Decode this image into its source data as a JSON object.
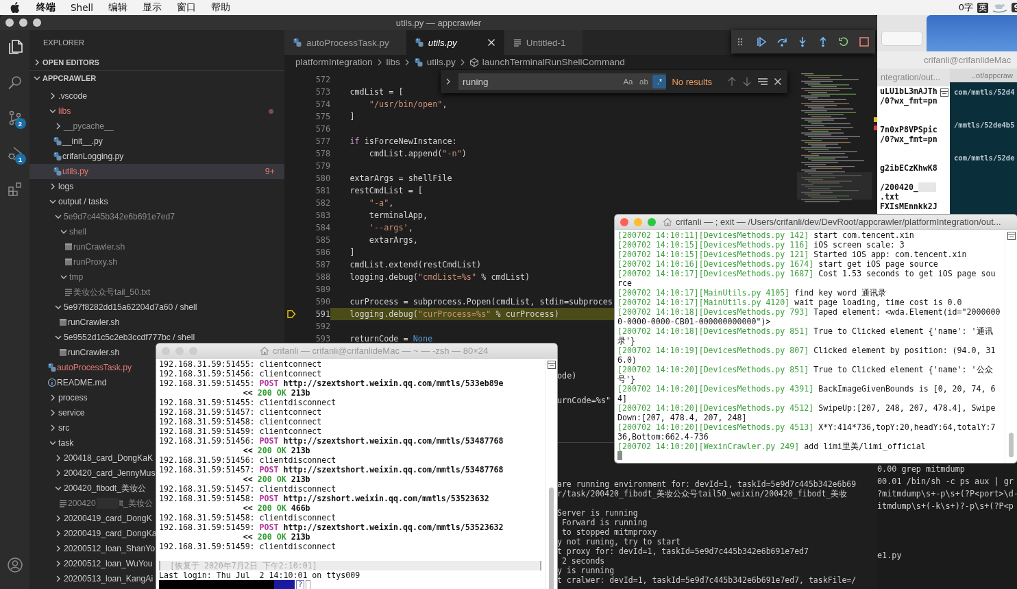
{
  "menubar": {
    "items": [
      "终端",
      "Shell",
      "编辑",
      "显示",
      "窗口",
      "帮助"
    ],
    "word_count": "0字",
    "input_method": "英"
  },
  "back_terminal": {
    "title": "crifanli@crifanlideMac",
    "tab": "..ot/appcraw",
    "upper_lines": [
      {
        "kind": "text",
        "text": "com/mmtls/52d4"
      },
      {
        "kind": "blank"
      },
      {
        "kind": "blank"
      },
      {
        "kind": "text",
        "text": "/mmtls/52de4b5"
      },
      {
        "kind": "blank"
      },
      {
        "kind": "blank"
      },
      {
        "kind": "text",
        "text": "com/mmtls/52de"
      }
    ],
    "lower_lines": [
      {
        "kind": "text",
        "text": "0.00 grep mitmdump"
      },
      {
        "kind": "text",
        "text": "00.01 /bin/sh -c ps aux | gr"
      },
      {
        "kind": "text",
        "text": "?mitmdump\\s+-p\\s+(?P<port>\\d-"
      },
      {
        "kind": "text",
        "text": "itmdump\\s+(-k\\s+)?-p\\s+(?P<p"
      },
      {
        "kind": "blank"
      },
      {
        "kind": "blank"
      },
      {
        "kind": "blank"
      },
      {
        "kind": "text",
        "text": "e1.py"
      }
    ]
  },
  "side_terminal": {
    "tab": "ntegration/out...",
    "lines": [
      {
        "kind": "text",
        "text": "uLU1bL3mAJTh"
      },
      {
        "kind": "text",
        "text": "/0?wx_fmt=pn"
      },
      {
        "kind": "blank"
      },
      {
        "kind": "blank"
      },
      {
        "kind": "text",
        "text": "7n0xP8VPSpic"
      },
      {
        "kind": "text",
        "text": "/0?wx_fmt=pn"
      },
      {
        "kind": "blank"
      },
      {
        "kind": "blank"
      },
      {
        "kind": "text",
        "text": "g2ibECzKhwK8"
      },
      {
        "kind": "blank"
      },
      {
        "kind": "redacted",
        "text": "/200420_"
      },
      {
        "kind": "text",
        "text": ".txt"
      },
      {
        "kind": "text",
        "text": "FXIsMEnnkk2J"
      }
    ]
  },
  "editor_window": {
    "title": "utils.py — appcrawler",
    "focused": false,
    "activity_bar": [
      {
        "kind": "files",
        "selected": true
      },
      {
        "kind": "search",
        "selected": false
      },
      {
        "kind": "source_control",
        "selected": false,
        "badge": "2"
      },
      {
        "kind": "debug",
        "selected": false,
        "badge": "1"
      },
      {
        "kind": "extensions",
        "selected": false
      }
    ],
    "sidebar": {
      "title": "EXPLORER",
      "sections": [
        {
          "label": "OPEN EDITORS",
          "expanded": false
        },
        {
          "label": "APPCRAWLER",
          "expanded": true
        }
      ],
      "tree": [
        {
          "name": ".vscode",
          "kind": "folder",
          "expanded": false,
          "selected": false,
          "modified": false,
          "ignored": false
        },
        {
          "name": "libs",
          "kind": "folder",
          "expanded": true,
          "selected": false,
          "modified": true,
          "ignored": false,
          "children": [
            {
              "name": "__pycache__",
              "kind": "folder",
              "expanded": false,
              "selected": false,
              "modified": false,
              "ignored": true
            },
            {
              "name": "__init__.py",
              "kind": "python",
              "selected": false,
              "modified": false,
              "ignored": false
            },
            {
              "name": "crifanLogging.py",
              "kind": "python",
              "selected": false,
              "modified": false,
              "ignored": false
            },
            {
              "name": "utils.py",
              "kind": "python",
              "selected": true,
              "modified": true,
              "ignored": false,
              "problems": "9+"
            }
          ]
        },
        {
          "name": "logs",
          "kind": "folder",
          "expanded": false,
          "selected": false,
          "modified": false,
          "ignored": false
        },
        {
          "name": "output / tasks",
          "kind": "folder",
          "expanded": true,
          "selected": false,
          "modified": false,
          "ignored": false,
          "children": [
            {
              "name": "5e9d7c445b342e6b691e7ed7",
              "kind": "folder",
              "expanded": true,
              "selected": false,
              "modified": false,
              "ignored": true,
              "children": [
                {
                  "name": "shell",
                  "kind": "folder",
                  "expanded": true,
                  "selected": false,
                  "modified": false,
                  "ignored": true,
                  "children": [
                    {
                      "name": "runCrawler.sh",
                      "kind": "shell",
                      "selected": false,
                      "modified": false,
                      "ignored": true
                    },
                    {
                      "name": "runProxy.sh",
                      "kind": "shell",
                      "selected": false,
                      "modified": false,
                      "ignored": true
                    }
                  ]
                },
                {
                  "name": "tmp",
                  "kind": "folder",
                  "expanded": true,
                  "selected": false,
                  "modified": false,
                  "ignored": true,
                  "children": [
                    {
                      "name": "美妆公众号tail_50.txt",
                      "kind": "text",
                      "selected": false,
                      "modified": false,
                      "ignored": true
                    }
                  ]
                }
              ]
            },
            {
              "name": "5e97f8282dd15a62204d7a60 / shell",
              "kind": "folder",
              "expanded": true,
              "selected": false,
              "modified": false,
              "ignored": false,
              "children": [
                {
                  "name": "runCrawler.sh",
                  "kind": "shell",
                  "selected": false,
                  "modified": false,
                  "ignored": false
                }
              ]
            },
            {
              "name": "5e9552d1c5c2eb3ccdf777bc / shell",
              "kind": "folder",
              "expanded": true,
              "selected": false,
              "modified": false,
              "ignored": false,
              "children": [
                {
                  "name": "runCrawler.sh",
                  "kind": "shell",
                  "selected": false,
                  "modified": false,
                  "ignored": false
                }
              ]
            }
          ]
        },
        {
          "name": "autoProcessTask.py",
          "kind": "python",
          "selected": false,
          "modified": true,
          "ignored": false
        },
        {
          "name": "README.md",
          "kind": "info",
          "selected": false,
          "modified": false,
          "ignored": false
        },
        {
          "name": "process",
          "kind": "folder",
          "expanded": false,
          "selected": false,
          "modified": false,
          "ignored": false
        },
        {
          "name": "service",
          "kind": "folder",
          "expanded": false,
          "selected": false,
          "modified": false,
          "ignored": false
        },
        {
          "name": "src",
          "kind": "folder",
          "expanded": false,
          "selected": false,
          "modified": false,
          "ignored": false
        },
        {
          "name": "task",
          "kind": "folder",
          "expanded": true,
          "selected": false,
          "modified": false,
          "ignored": false,
          "children": [
            {
              "name": "200418_card_DongKaK",
              "kind": "folder",
              "expanded": false,
              "selected": false,
              "modified": false,
              "ignored": false
            },
            {
              "name": "200420_card_JennyMus",
              "kind": "folder",
              "expanded": false,
              "selected": false,
              "modified": false,
              "ignored": false
            },
            {
              "name": "200420_fibodt_美妆公",
              "kind": "folder",
              "expanded": true,
              "selected": false,
              "modified": false,
              "ignored": false,
              "children": [
                {
                  "name": "200420",
                  "name_after_redaction": "lt_美妆公",
                  "kind": "text",
                  "selected": false,
                  "modified": false,
                  "ignored": true
                }
              ]
            },
            {
              "name": "20200419_card_DongK",
              "kind": "folder",
              "expanded": false,
              "selected": false,
              "modified": false,
              "ignored": false
            },
            {
              "name": "20200419_card_DongKa",
              "kind": "folder",
              "expanded": false,
              "selected": false,
              "modified": false,
              "ignored": false
            },
            {
              "name": "20200512_loan_ShanYo",
              "kind": "folder",
              "expanded": false,
              "selected": false,
              "modified": false,
              "ignored": false
            },
            {
              "name": "20200512_loan_WuYou",
              "kind": "folder",
              "expanded": false,
              "selected": false,
              "modified": false,
              "ignored": false
            },
            {
              "name": "20200513_loan_KangAi",
              "kind": "folder",
              "expanded": false,
              "selected": false,
              "modified": false,
              "ignored": false
            }
          ]
        }
      ]
    },
    "tabs": [
      {
        "label": "autoProcessTask.py",
        "kind": "python",
        "selected": false
      },
      {
        "label": "utils.py",
        "kind": "python",
        "selected": true
      },
      {
        "label": "Untitled-1",
        "kind": "text",
        "selected": false
      }
    ],
    "breadcrumbs": [
      {
        "label": "platformIntegration",
        "kind": "folder"
      },
      {
        "label": "libs",
        "kind": "folder"
      },
      {
        "label": "utils.py",
        "kind": "python"
      },
      {
        "label": "launchTerminalRunShellCommand",
        "kind": "symbol"
      }
    ],
    "find_widget": {
      "value": "runing",
      "options": [
        {
          "label": "Aa",
          "on": false
        },
        {
          "label": "ab",
          "on": false
        },
        {
          "label": ".*",
          "on": true
        }
      ],
      "result": "No results"
    },
    "debug_toolbar": [
      {
        "kind": "grip"
      },
      {
        "kind": "continue"
      },
      {
        "kind": "step_over"
      },
      {
        "kind": "step_into"
      },
      {
        "kind": "step_out"
      },
      {
        "kind": "restart"
      },
      {
        "kind": "stop"
      }
    ],
    "code_lines": [
      {
        "kind": "line",
        "number": "572",
        "current": false
      },
      {
        "kind": "line",
        "number": "573",
        "text": "    cmdList = [",
        "current": false
      },
      {
        "kind": "line",
        "number": "574",
        "text": "        \"/usr/bin/open\",",
        "current": false
      },
      {
        "kind": "line",
        "number": "575",
        "text": "    ]",
        "current": false
      },
      {
        "kind": "line",
        "number": "576",
        "current": false
      },
      {
        "kind": "line",
        "number": "577",
        "text": "    if isForceNewInstance:",
        "current": false
      },
      {
        "kind": "line",
        "number": "578",
        "text": "        cmdList.append(\"-n\")",
        "current": false
      },
      {
        "kind": "line",
        "number": "579",
        "current": false
      },
      {
        "kind": "line",
        "number": "580",
        "text": "    extarArgs = shellFile",
        "current": false
      },
      {
        "kind": "line",
        "number": "581",
        "text": "    restCmdList = [",
        "current": false
      },
      {
        "kind": "line",
        "number": "582",
        "text": "        \"-a\",",
        "current": false
      },
      {
        "kind": "line",
        "number": "583",
        "text": "        terminalApp,",
        "current": false
      },
      {
        "kind": "line",
        "number": "584",
        "text": "        '--args',",
        "current": false
      },
      {
        "kind": "line",
        "number": "585",
        "text": "        extarArgs,",
        "current": false
      },
      {
        "kind": "line",
        "number": "586",
        "text": "    ]",
        "current": false
      },
      {
        "kind": "line",
        "number": "587",
        "text": "    cmdList.extend(restCmdList)",
        "current": false
      },
      {
        "kind": "line",
        "number": "588",
        "text": "    logging.debug(\"cmdList=%s\" % cmdList)",
        "current": false
      },
      {
        "kind": "line",
        "number": "589",
        "current": false
      },
      {
        "kind": "line",
        "number": "590",
        "text": "    curProcess = subprocess.Popen(cmdList, stdin=subproces",
        "current": false
      },
      {
        "kind": "line",
        "number": "591",
        "text": "    logging.debug(\"curProcess=%s\" % curProcess)",
        "current": true
      },
      {
        "kind": "line",
        "number": "592",
        "current": false
      },
      {
        "kind": "line",
        "number": "593",
        "text": "    returnCode = None",
        "current": false
      },
      {
        "kind": "covered"
      },
      {
        "kind": "covered"
      },
      {
        "kind": "fragment",
        "text": "ode)"
      },
      {
        "kind": "covered"
      },
      {
        "kind": "fragment",
        "text": "urnCode=%s\""
      }
    ],
    "panel_lines": [
      {
        "kind": "text",
        "text": "are running environment for: devId=1, taskId=5e9d7c445b342e6b69"
      },
      {
        "kind": "text",
        "text": "r/task/200420_fibodt_美妆公众号tail50_weixin/200420_fibodt_美妆"
      },
      {
        "kind": "blank"
      },
      {
        "kind": "text",
        "text": "Server is running"
      },
      {
        "kind": "text",
        "text": " Forward is running"
      },
      {
        "kind": "text",
        "text": " to stopped mitmproxy"
      },
      {
        "kind": "text",
        "text": "y not runing, try to start"
      },
      {
        "kind": "text",
        "text": "t proxy for: devId=1, taskId=5e9d7c445b342e6b691e7ed7"
      },
      {
        "kind": "text",
        "text": " 2 seconds"
      },
      {
        "kind": "text",
        "text": "y is running"
      },
      {
        "kind": "text",
        "text": "t cralwer: devId=1, taskId=5e9d7c445b342e6b691e7ed7, taskFile=/"
      }
    ]
  },
  "right_terminal": {
    "title": "crifanli — ; exit — /Users/crifanli/dev/DevRoot/appcrawler/platformIntegration/out...",
    "focused": true,
    "lines": [
      {
        "prefix": "[200702 14:10:11][DevicesMethods.py 142]",
        "message": "start com.tencent.xin"
      },
      {
        "prefix": "[200702 14:10:15][DevicesMethods.py 116]",
        "message": "iOS screen scale: 3"
      },
      {
        "prefix": "[200702 14:10:15][DevicesMethods.py 121]",
        "message": "Started iOS app: com.tencent.xin"
      },
      {
        "prefix": "[200702 14:10:16][DevicesMethods.py 1674]",
        "message": "start get iOS page source"
      },
      {
        "prefix": "[200702 14:10:17][DevicesMethods.py 1687]",
        "message": "Cost 1.53 seconds to get iOS page source"
      },
      {
        "prefix": "[200702 14:10:17][MainUtils.py 4105]",
        "message": "find key word 通讯录"
      },
      {
        "prefix": "[200702 14:10:17][MainUtils.py 4120]",
        "message": "wait page loading, time cost is 0.0"
      },
      {
        "prefix": "[200702 14:10:18][DevicesMethods.py 793]",
        "message": "Taped element: <wda.Element(id=\"20000000-0000-0000-CB01-000000000000\")>"
      },
      {
        "prefix": "[200702 14:10:18][DevicesMethods.py 851]",
        "message": "True to Clicked element {'name': '通讯录'}"
      },
      {
        "prefix": "[200702 14:10:19][DevicesMethods.py 807]",
        "message": "Clicked element by position: (94.0, 316.0)"
      },
      {
        "prefix": "[200702 14:10:20][DevicesMethods.py 851]",
        "message": "True to Clicked element {'name': '公众号'}"
      },
      {
        "prefix": "[200702 14:10:20][DevicesMethods.py 4391]",
        "message": "BackImageGivenBounds is [0, 20, 74, 64]"
      },
      {
        "prefix": "[200702 14:10:20][DevicesMethods.py 4512]",
        "message": "SwipeUp:[207, 248, 207, 478.4], SwipeDown:[207, 478.4, 207, 248]"
      },
      {
        "prefix": "[200702 14:10:20][DevicesMethods.py 4513]",
        "message": "X*Y:414*736,topY:20,headY:64,totalY:736,Bottom:662.4-736"
      },
      {
        "prefix": "[200702 14:10:20][WexinCrawler.py 249]",
        "message": "add limi里美/limi_official"
      }
    ]
  },
  "left_terminal": {
    "title": "crifanli — crifanli@crifanlideMac — ~ — -zsh — 80×24",
    "focused": false,
    "lines": [
      {
        "kind": "event",
        "address": "192.168.31.59:51455:",
        "text": "clientconnect"
      },
      {
        "kind": "event",
        "address": "192.168.31.59:51456:",
        "text": "clientconnect"
      },
      {
        "kind": "request",
        "address": "192.168.31.59:51455:",
        "method": "POST",
        "url": "http://szextshort.weixin.qq.com/mmtls/533eb89e"
      },
      {
        "kind": "response",
        "marker": "<<",
        "status": "200 OK",
        "size": "213b"
      },
      {
        "kind": "event",
        "address": "192.168.31.59:51455:",
        "text": "clientdisconnect"
      },
      {
        "kind": "event",
        "address": "192.168.31.59:51457:",
        "text": "clientconnect"
      },
      {
        "kind": "event",
        "address": "192.168.31.59:51458:",
        "text": "clientconnect"
      },
      {
        "kind": "event",
        "address": "192.168.31.59:51459:",
        "text": "clientconnect"
      },
      {
        "kind": "request",
        "address": "192.168.31.59:51456:",
        "method": "POST",
        "url": "http://szextshort.weixin.qq.com/mmtls/53487768"
      },
      {
        "kind": "response",
        "marker": "<<",
        "status": "200 OK",
        "size": "213b"
      },
      {
        "kind": "event",
        "address": "192.168.31.59:51456:",
        "text": "clientdisconnect"
      },
      {
        "kind": "request",
        "address": "192.168.31.59:51457:",
        "method": "POST",
        "url": "http://szextshort.weixin.qq.com/mmtls/53487768"
      },
      {
        "kind": "response",
        "marker": "<<",
        "status": "200 OK",
        "size": "213b"
      },
      {
        "kind": "event",
        "address": "192.168.31.59:51457:",
        "text": "clientdisconnect"
      },
      {
        "kind": "request",
        "address": "192.168.31.59:51458:",
        "method": "POST",
        "url": "http://szshort.weixin.qq.com/mmtls/53523632"
      },
      {
        "kind": "response",
        "marker": "<<",
        "status": "200 OK",
        "size": "466b"
      },
      {
        "kind": "event",
        "address": "192.168.31.59:51458:",
        "text": "clientdisconnect"
      },
      {
        "kind": "request",
        "address": "192.168.31.59:51459:",
        "method": "POST",
        "url": "http://szextshort.weixin.qq.com/mmtls/53523632"
      },
      {
        "kind": "response",
        "marker": "<<",
        "status": "200 OK",
        "size": "213b"
      },
      {
        "kind": "event",
        "address": "192.168.31.59:51459:",
        "text": "clientdisconnect"
      }
    ],
    "restored": "[恢复于 2020年7月2日 下午2:10:01]",
    "last_login": "Last login: Thu Jul  2 14:10:01 on ttys009",
    "prompt_glyph": "?"
  }
}
